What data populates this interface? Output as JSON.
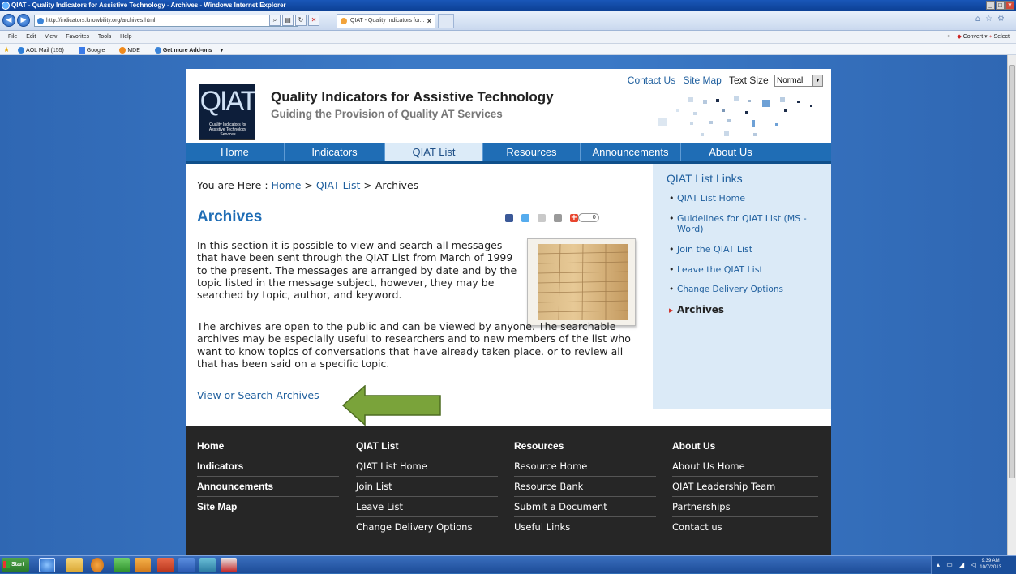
{
  "browser": {
    "window_title": "QIAT - Quality Indicators for Assistive Technology - Archives - Windows Internet Explorer",
    "url": "http://indicators.knowbility.org/archives.html",
    "tab_label": "QIAT - Quality Indicators for...",
    "menu": [
      "File",
      "Edit",
      "View",
      "Favorites",
      "Tools",
      "Help"
    ],
    "command_bar": {
      "convert": "Convert",
      "select": "Select"
    },
    "favorites": [
      "AOL Mail (155)",
      "Google",
      "MDE",
      "Get more Add-ons"
    ]
  },
  "site": {
    "logo": {
      "mark": "QIAT",
      "text": "Quality Indicators for Assistive Technology Services"
    },
    "title": "Quality Indicators for Assistive Technology",
    "tagline": "Guiding the Provision of Quality AT Services",
    "utility": {
      "contact": "Contact Us",
      "sitemap": "Site Map",
      "text_size_label": "Text Size",
      "text_size_value": "Normal"
    },
    "nav": [
      {
        "label": "Home"
      },
      {
        "label": "Indicators"
      },
      {
        "label": "QIAT List"
      },
      {
        "label": "Resources"
      },
      {
        "label": "Announcements"
      },
      {
        "label": "About Us"
      }
    ]
  },
  "main": {
    "breadcrumb": {
      "prefix": "You are Here : ",
      "home": "Home",
      "sep": " > ",
      "section": "QIAT List",
      "current": "Archives"
    },
    "heading": "Archives",
    "share_count": "0",
    "para1": "In this section it is possible to view and search all messages that have been sent through the QIAT List from March of 1999 to the present. The messages are arranged by date and by the topic listed in the message subject, however, they may be searched by topic, author, and keyword.",
    "para2": "The archives are open to the public and can be viewed by anyone. The searchable archives may be especially useful to researchers and to new members of the list who want to know topics of conversations that have already taken place. or to review all that has been said on a specific topic.",
    "link": "View or Search Archives",
    "arrow_color": "#7aa33a"
  },
  "sidebar": {
    "title": "QIAT List Links",
    "items": [
      "QIAT List Home",
      "Guidelines for QIAT List (MS - Word)",
      "Join the QIAT List",
      "Leave the QIAT List",
      "Change Delivery Options",
      "Archives"
    ]
  },
  "footer": {
    "col1": {
      "items": [
        "Home",
        "Indicators",
        "Announcements",
        "Site Map"
      ]
    },
    "col2": {
      "heading": "QIAT List",
      "items": [
        "QIAT List Home",
        "Join List",
        "Leave List",
        "Change Delivery Options"
      ]
    },
    "col3": {
      "heading": "Resources",
      "items": [
        "Resource Home",
        "Resource Bank",
        "Submit a Document",
        "Useful Links"
      ]
    },
    "col4": {
      "heading": "About Us",
      "items": [
        "About Us Home",
        "QIAT Leadership Team",
        "Partnerships",
        "Contact us"
      ]
    }
  },
  "taskbar": {
    "start": "Start",
    "time": "9:39 AM",
    "date": "10/7/2013"
  },
  "colors": {
    "nav_blue": "#1f6db5",
    "link_blue": "#1f5f9e",
    "footer_bg": "#262626",
    "sidebar_bg": "#dbeaf7"
  }
}
